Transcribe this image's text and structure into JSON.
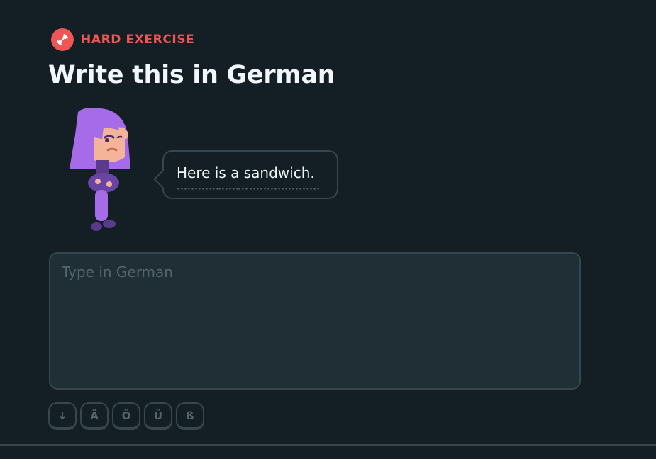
{
  "exercise": {
    "badge_label": "HARD EXERCISE",
    "badge_icon": "dumbbell-icon",
    "badge_color": "#ee5555",
    "title": "Write this in German"
  },
  "prompt": {
    "sentence": "Here is a sandwich.",
    "words": [
      "Here",
      "is",
      "a",
      "sandwich."
    ]
  },
  "answer": {
    "value": "",
    "placeholder": "Type in German"
  },
  "special_keys": [
    "↓",
    "Ä",
    "Ö",
    "Ü",
    "ß"
  ],
  "colors": {
    "background": "#131f24",
    "input_background": "#202f36",
    "border": "#37464f",
    "text": "#f1f7fb",
    "muted": "#52656d",
    "character_hair": "#a56be8",
    "character_body": "#7f4fc9"
  }
}
